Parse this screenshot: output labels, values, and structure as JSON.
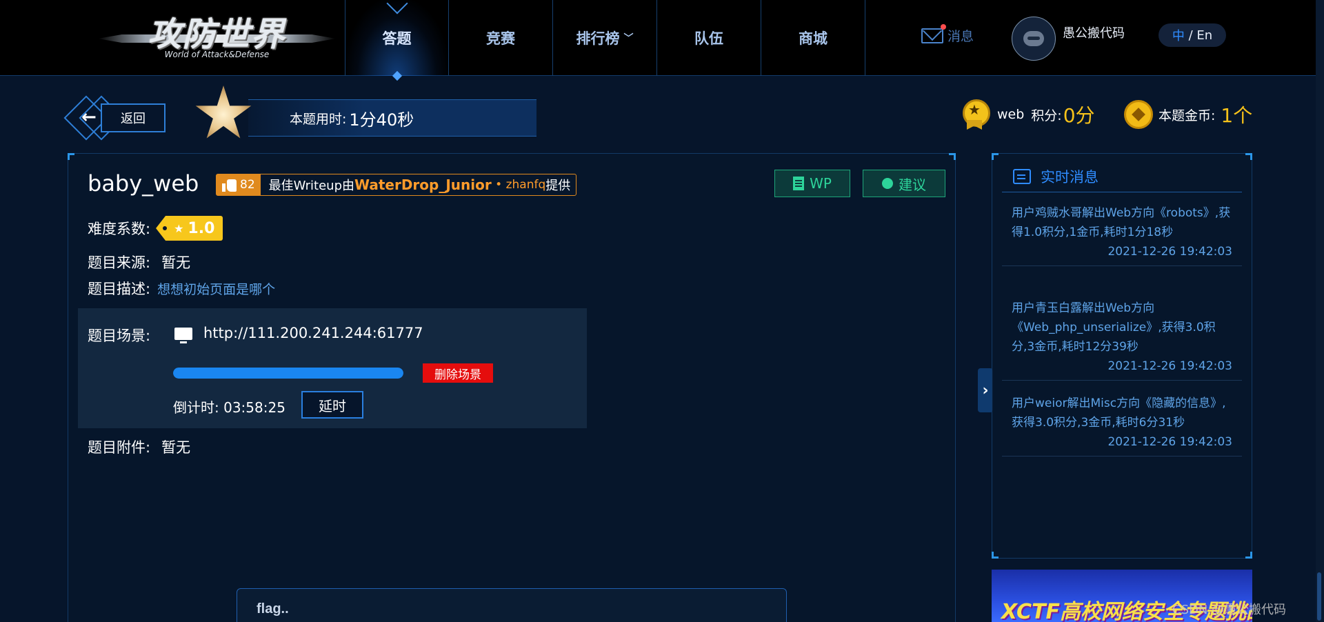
{
  "header": {
    "logo_title": "攻防世界",
    "logo_subtitle": "World of Attack&Defense",
    "nav": [
      {
        "label": "答题",
        "active": true
      },
      {
        "label": "竞赛",
        "active": false
      },
      {
        "label": "排行榜",
        "active": false,
        "dropdown": true
      },
      {
        "label": "队伍",
        "active": false
      },
      {
        "label": "商城",
        "active": false
      }
    ],
    "messages_label": "消息",
    "username": "愚公搬代码",
    "lang_zh": "中",
    "lang_sep": " / ",
    "lang_en": "En"
  },
  "status": {
    "back_label": "返回",
    "time_label": "本题用时:",
    "time_value": "1分40秒",
    "category": "web",
    "score_label": "积分:",
    "score_value": "0分",
    "coin_label": "本题金币:",
    "coin_value": "1个"
  },
  "task": {
    "title": "baby_web",
    "likes": "82",
    "writeup_prefix": "最佳Writeup由",
    "writeup_author": "WaterDrop_Junior",
    "writeup_sep": " • ",
    "writeup_coauthor": "zhanfq",
    "writeup_suffix": "提供",
    "wp_label": "WP",
    "suggest_label": "建议",
    "difficulty_label": "难度系数:",
    "difficulty_value": "1.0",
    "source_label": "题目来源:",
    "source_value": "暂无",
    "description_label": "题目描述:",
    "description_value": "想想初始页面是哪个",
    "scene_label": "题目场景:",
    "scene_url": "http://111.200.241.244:61777",
    "scene_progress": 1.0,
    "delete_scene_label": "删除场景",
    "countdown_label": "倒计时:",
    "countdown_value": "03:58:25",
    "delay_label": "延时",
    "attachment_label": "题目附件:",
    "attachment_value": "暂无",
    "flag_placeholder": "flag.."
  },
  "news": {
    "title": "实时消息",
    "items": [
      {
        "text": "用户鸡贼水哥解出Web方向《robots》,获得1.0积分,1金币,耗时1分18秒",
        "time": "2021-12-26 19:42:03"
      },
      {
        "text": "用户青玉白露解出Web方向《Web_php_unserialize》,获得3.0积分,3金币,耗时12分39秒",
        "time": "2021-12-26 19:42:03"
      },
      {
        "text": "用户weior解出Misc方向《隐藏的信息》,获得3.0积分,3金币,耗时6分31秒",
        "time": "2021-12-26 19:42:03"
      }
    ]
  },
  "banner": {
    "text": "XCTF高校网络安全专题挑战赛"
  },
  "watermark": "CSDN @愚公搬代码",
  "colors": {
    "accent": "#2f8cff",
    "gold": "#f7c21a",
    "danger": "#e50d0d",
    "green": "#2dd49a",
    "orange": "#e08a1e"
  }
}
